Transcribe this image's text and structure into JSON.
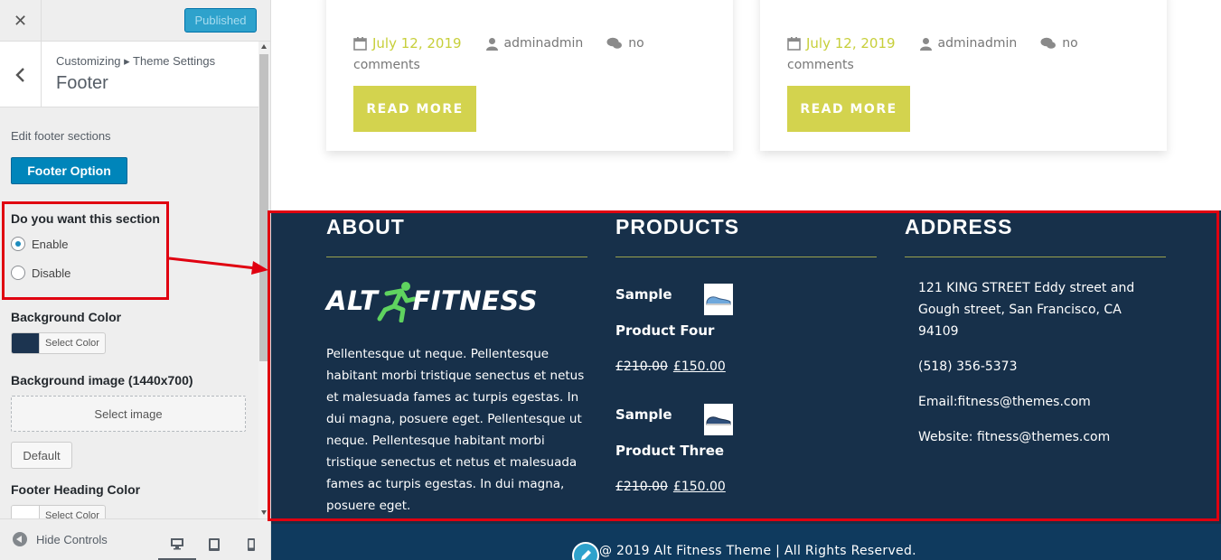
{
  "topbar": {
    "close_label": "✕",
    "published_label": "Published"
  },
  "section": {
    "breadcrumb": "Customizing ▸ Theme Settings",
    "title": "Footer"
  },
  "controls": {
    "description": "Edit footer sections",
    "footer_option_label": "Footer Option",
    "section_toggle": {
      "label": "Do you want this section",
      "options": [
        "Enable",
        "Disable"
      ],
      "selected": "Enable"
    },
    "background_color": {
      "label": "Background Color",
      "value": "#1c3450",
      "button": "Select Color"
    },
    "background_image": {
      "label": "Background image (1440x700)",
      "button": "Select image",
      "default_label": "Default"
    },
    "footer_heading_color": {
      "label": "Footer Heading Color",
      "value": "#ffffff",
      "button": "Select Color"
    }
  },
  "bottom_bar": {
    "hide_controls_label": "Hide Controls",
    "devices": [
      "desktop-icon",
      "tablet-icon",
      "mobile-icon"
    ],
    "active_device": "desktop"
  },
  "posts": [
    {
      "date": "July 12, 2019",
      "author": "adminadmin",
      "comments_prefix": "no",
      "comments_suffix": "comments",
      "button": "READ MORE"
    },
    {
      "date": "July 12, 2019",
      "author": "adminadmin",
      "comments_prefix": "no",
      "comments_suffix": "comments",
      "button": "READ MORE"
    }
  ],
  "footer": {
    "about": {
      "heading": "ABOUT",
      "logo_left": "ALT",
      "logo_right": "FITNESS",
      "text": "Pellentesque ut neque. Pellentesque habitant morbi tristique senectus et netus et malesuada fames ac turpis egestas. In dui magna, posuere eget. Pellentesque ut neque. Pellentesque habitant morbi tristique senectus et netus et malesuada fames ac turpis egestas. In dui magna, posuere eget."
    },
    "products": {
      "heading": "PRODUCTS",
      "items": [
        {
          "name_line1": "Sample",
          "name_line2": "Product Four",
          "old_price": "£210.00",
          "new_price": "£150.00"
        },
        {
          "name_line1": "Sample",
          "name_line2": "Product Three",
          "old_price": "£210.00",
          "new_price": "£150.00"
        }
      ]
    },
    "address": {
      "heading": "ADDRESS",
      "street": "121 KING STREET Eddy street and Gough street, San Francisco, CA 94109",
      "phone": "(518) 356-5373",
      "email": "Email:fitness@themes.com",
      "website": "Website: fitness@themes.com"
    }
  },
  "copyright": "@ 2019 Alt Fitness Theme | All Rights Reserved.",
  "colors": {
    "footer_bg": "#17304a",
    "accent_yellow": "#d3d34e",
    "wp_blue": "#0085ba",
    "highlight_red": "#e00010"
  }
}
